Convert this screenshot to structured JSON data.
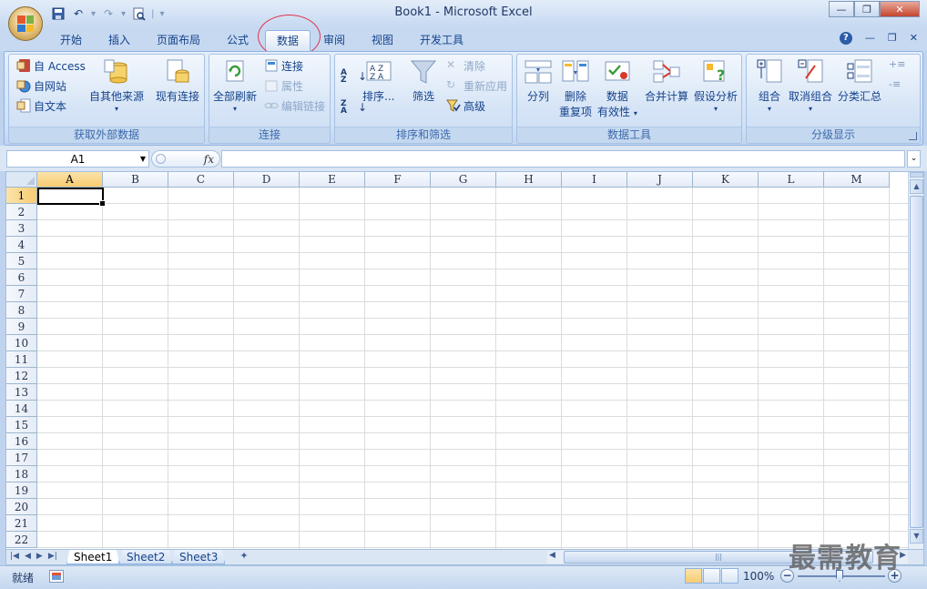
{
  "window": {
    "title": "Book1 - Microsoft Excel"
  },
  "ribbon_tabs": [
    {
      "label": "开始"
    },
    {
      "label": "插入"
    },
    {
      "label": "页面布局"
    },
    {
      "label": "公式"
    },
    {
      "label": "数据",
      "active": true
    },
    {
      "label": "审阅"
    },
    {
      "label": "视图"
    },
    {
      "label": "开发工具"
    }
  ],
  "groups": {
    "external": {
      "label": "获取外部数据",
      "access": "自 Access",
      "web": "自网站",
      "text": "自文本",
      "other": "自其他来源",
      "existing": "现有连接"
    },
    "connections": {
      "label": "连接",
      "refresh_all": "全部刷新",
      "connections": "连接",
      "properties": "属性",
      "edit_links": "编辑链接"
    },
    "sort_filter": {
      "label": "排序和筛选",
      "sort": "排序...",
      "filter": "筛选",
      "clear": "清除",
      "reapply": "重新应用",
      "advanced": "高级"
    },
    "data_tools": {
      "label": "数据工具",
      "text_to_columns": "分列",
      "remove_dup_1": "删除",
      "remove_dup_2": "重复项",
      "validation_1": "数据",
      "validation_2": "有效性",
      "consolidate": "合并计算",
      "whatif": "假设分析"
    },
    "outline": {
      "label": "分级显示",
      "group": "组合",
      "ungroup": "取消组合",
      "subtotal": "分类汇总"
    }
  },
  "formula_bar": {
    "name_box": "A1",
    "fx": "fx",
    "formula": ""
  },
  "columns": [
    "A",
    "B",
    "C",
    "D",
    "E",
    "F",
    "G",
    "H",
    "I",
    "J",
    "K",
    "L",
    "M"
  ],
  "rows": [
    "1",
    "2",
    "3",
    "4",
    "5",
    "6",
    "7",
    "8",
    "9",
    "10",
    "11",
    "12",
    "13",
    "14",
    "15",
    "16",
    "17",
    "18",
    "19",
    "20",
    "21",
    "22"
  ],
  "selected_cell": "A1",
  "sheets": [
    {
      "name": "Sheet1",
      "active": true
    },
    {
      "name": "Sheet2"
    },
    {
      "name": "Sheet3"
    }
  ],
  "status": {
    "ready": "就绪",
    "zoom": "100%"
  },
  "watermark": "最需教育",
  "colors": {
    "accent": "#15428b",
    "highlight_circle": "#e0334d",
    "selected_header": "#f7cc72"
  }
}
